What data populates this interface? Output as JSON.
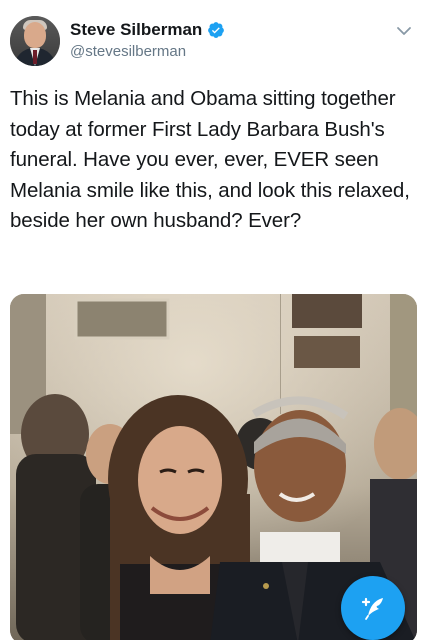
{
  "tweet": {
    "author_name": "Steve Silberman",
    "author_handle": "@stevesilberman",
    "verified": true,
    "text": "This is Melania and Obama sitting together today at former First Lady Barbara Bush's funeral. Have you ever, ever, EVER seen Melania smile like this, and look this relaxed, beside her own husband? Ever?"
  },
  "icons": {
    "verified": "verified-badge-icon",
    "menu": "chevron-down-icon",
    "compose": "compose-tweet-icon"
  },
  "colors": {
    "accent": "#1da1f2",
    "text": "#14171a",
    "secondary": "#657786"
  }
}
